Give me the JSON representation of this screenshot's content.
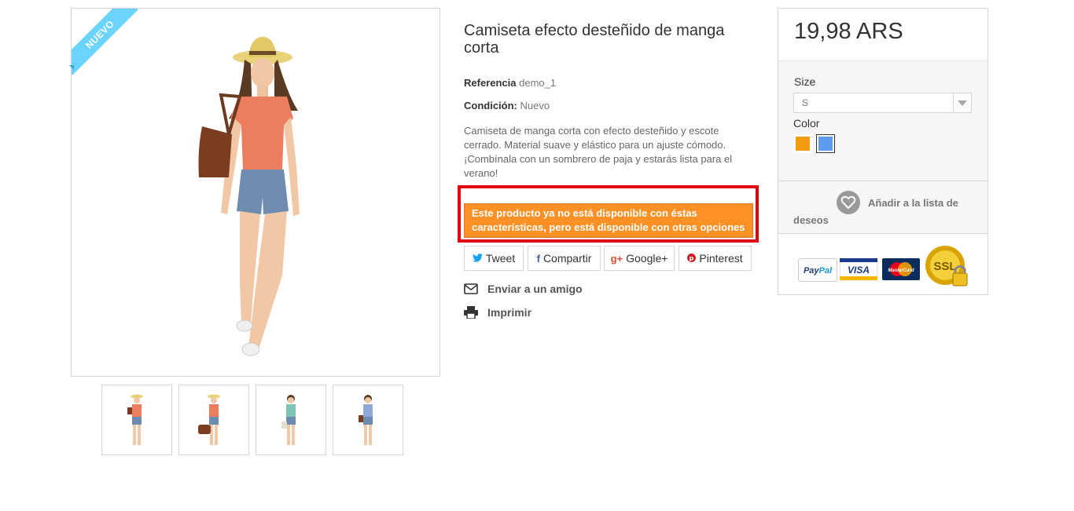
{
  "badge": {
    "label": "NUEVO"
  },
  "product": {
    "title": "Camiseta efecto desteñido de manga corta",
    "reference_label": "Referencia",
    "reference_value": "demo_1",
    "condition_label": "Condición:",
    "condition_value": "Nuevo",
    "description": "Camiseta de manga corta con efecto desteñido y escote cerrado. Material suave y elástico para un ajuste cómodo. ¡Combínala con un sombrero de paja y estarás lista para el verano!",
    "availability_alert": "Este producto ya no está disponible con éstas características, pero está disponible con otras opciones"
  },
  "social": {
    "tweet": "Tweet",
    "share": "Compartir",
    "googleplus": "Google+",
    "pinterest": "Pinterest"
  },
  "links": {
    "send_friend": "Enviar a un amigo",
    "print": "Imprimir"
  },
  "buybox": {
    "price": "19,98 ARS",
    "size_label": "Size",
    "size_value": "S",
    "color_label": "Color",
    "colors": [
      "#f39c11",
      "#5d9cec"
    ],
    "wishlist_line1": "Añadir a la lista de",
    "wishlist_line2": "deseos"
  },
  "payment_icons": [
    "paypal-icon",
    "visa-icon",
    "mastercard-icon",
    "ssl-lock-icon"
  ]
}
